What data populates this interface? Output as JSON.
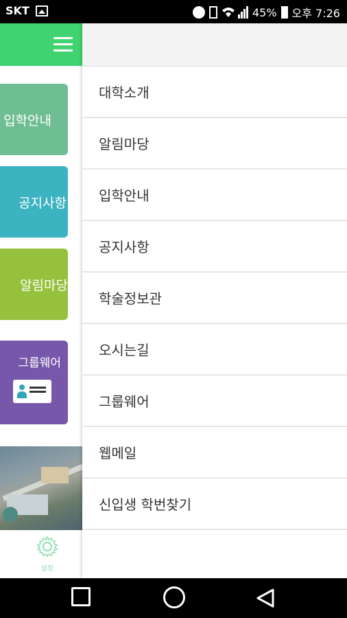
{
  "status_bar": {
    "carrier": "SKT",
    "battery": "45%",
    "time": "오후 7:26"
  },
  "left_panel": {
    "tiles": [
      {
        "label": "입학안내"
      },
      {
        "label": "공지사항"
      },
      {
        "label": "알림마당"
      },
      {
        "label": "그룹웨어"
      }
    ],
    "settings_label": "설정"
  },
  "drawer": {
    "items": [
      {
        "label": "대학소개"
      },
      {
        "label": "알림마당"
      },
      {
        "label": "입학안내"
      },
      {
        "label": "공지사항"
      },
      {
        "label": "학술정보관"
      },
      {
        "label": "오시는길"
      },
      {
        "label": "그룹웨어"
      },
      {
        "label": "웹메일"
      },
      {
        "label": "신입생 학번찾기"
      }
    ]
  },
  "colors": {
    "header_green": "#3fd46f",
    "tile_green": "#6fbd92",
    "tile_teal": "#3bb3c1",
    "tile_lime": "#95c13c",
    "tile_purple": "#7757a9"
  }
}
